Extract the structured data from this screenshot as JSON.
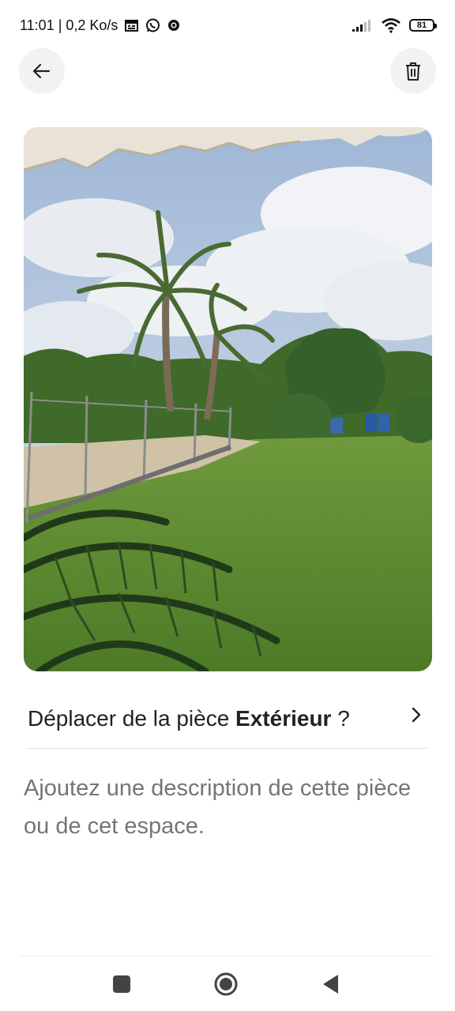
{
  "status_bar": {
    "time_speed": "11:01 | 0,2 Ko/s",
    "battery": "81",
    "icons": [
      "calendar-icon",
      "whatsapp-icon",
      "chrome-icon",
      "signal-icon",
      "wifi-icon",
      "battery-icon"
    ]
  },
  "header": {
    "back_icon": "arrow-left-icon",
    "delete_icon": "trash-icon"
  },
  "photo": {
    "subject": "garden-photo"
  },
  "move_row": {
    "prefix": "Déplacer de la pièce ",
    "room": "Extérieur",
    "suffix": " ?",
    "chevron_icon": "chevron-right-icon"
  },
  "description": {
    "placeholder": "Ajoutez une description de cette pièce ou de cet espace."
  },
  "nav_bar": {
    "icons": [
      "recent-apps-icon",
      "home-icon",
      "back-triangle-icon"
    ]
  },
  "colors": {
    "text_primary": "#222222",
    "text_secondary": "#6a6a6a",
    "button_bg": "#f2f2f2",
    "divider": "#dddddd"
  }
}
